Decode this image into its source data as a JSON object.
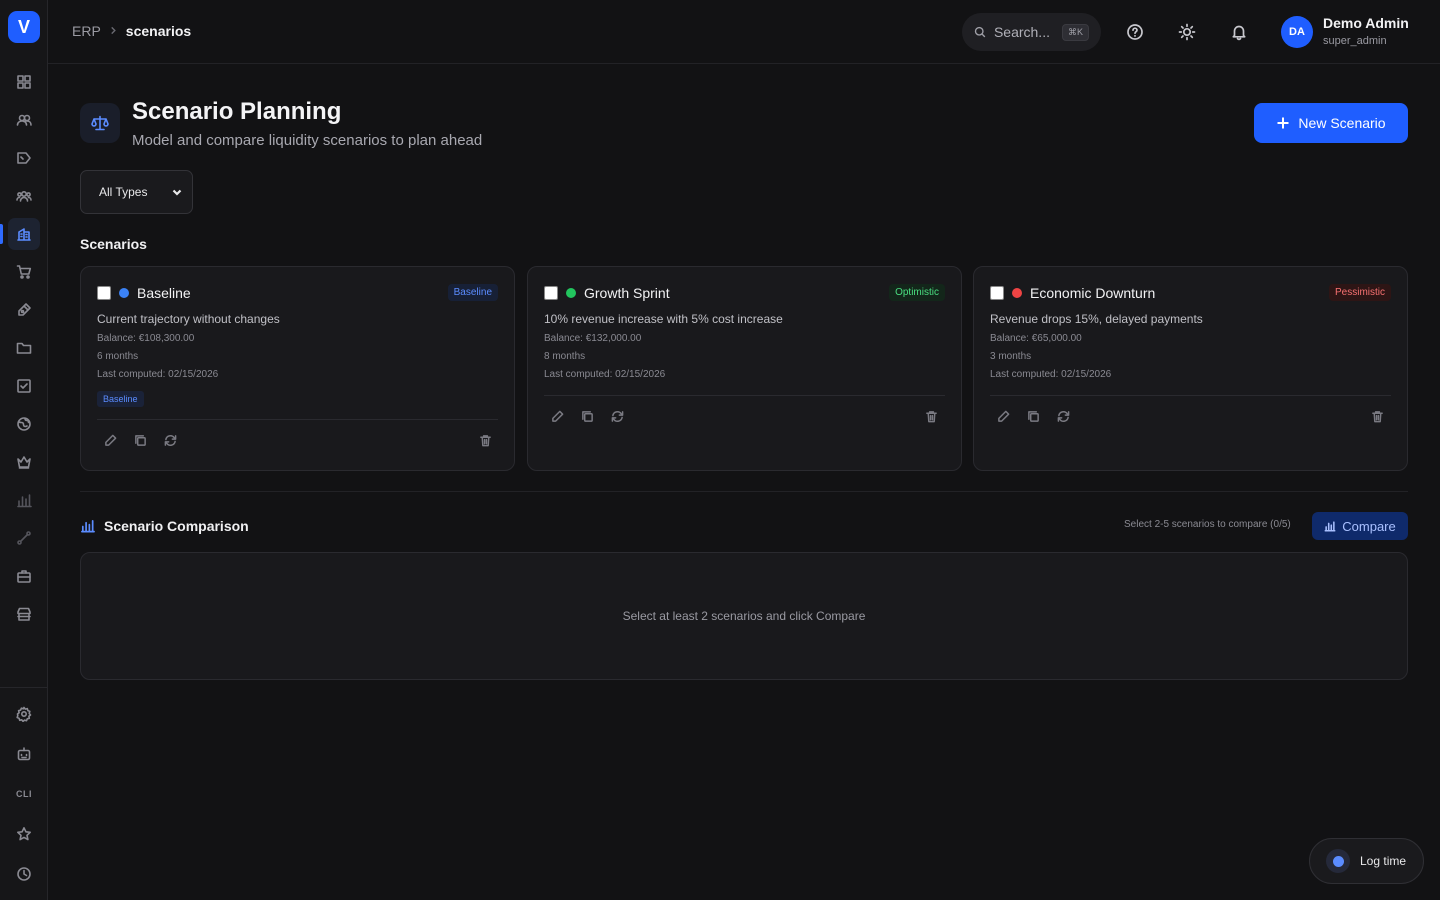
{
  "app": {
    "logo_letter": "V"
  },
  "breadcrumb": {
    "root": "ERP",
    "separator": ">",
    "current": "scenarios"
  },
  "header": {
    "search_placeholder": "Search...",
    "search_shortcut": "⌘K",
    "user": {
      "initials": "DA",
      "name": "Demo Admin",
      "role": "super_admin"
    }
  },
  "sidebar": {
    "items": [
      {
        "icon": "dashboard-icon"
      },
      {
        "icon": "users-icon"
      },
      {
        "icon": "tag-icon"
      },
      {
        "icon": "team-icon"
      },
      {
        "icon": "finance-icon",
        "active": true
      },
      {
        "icon": "cart-icon"
      },
      {
        "icon": "pen-icon"
      },
      {
        "icon": "folder-icon"
      },
      {
        "icon": "task-icon"
      },
      {
        "icon": "globe-icon"
      },
      {
        "icon": "crown-icon"
      },
      {
        "icon": "chart-icon"
      },
      {
        "icon": "route-icon"
      },
      {
        "icon": "briefcase-icon"
      },
      {
        "icon": "store-icon"
      }
    ],
    "bottom": [
      {
        "icon": "settings-icon"
      },
      {
        "icon": "bot-icon"
      },
      {
        "icon": "cli-icon",
        "label": "CLI"
      },
      {
        "icon": "star-icon"
      },
      {
        "icon": "clock-icon"
      }
    ],
    "accent": "#2f6bff"
  },
  "page": {
    "title": "Scenario Planning",
    "subtitle": "Model and compare liquidity scenarios to plan ahead",
    "new_button": "New Scenario",
    "filter_value": "All Types",
    "section_label": "Scenarios"
  },
  "scenarios": [
    {
      "name": "Baseline",
      "badge": "Baseline",
      "dot_color": "#3b82f6",
      "badge_color": "#5b8cff",
      "badge_bg": "#172036",
      "description": "Current trajectory without changes",
      "balance": "Balance: €108,300.00",
      "duration": "6 months",
      "last_computed": "Last computed: 02/15/2026",
      "tag": "Baseline"
    },
    {
      "name": "Growth Sprint",
      "badge": "Optimistic",
      "dot_color": "#22c55e",
      "badge_color": "#4ade80",
      "badge_bg": "#13261a",
      "description": "10% revenue increase with 5% cost increase",
      "balance": "Balance: €132,000.00",
      "duration": "8 months",
      "last_computed": "Last computed: 02/15/2026"
    },
    {
      "name": "Economic Downturn",
      "badge": "Pessimistic",
      "dot_color": "#ef4444",
      "badge_color": "#f87171",
      "badge_bg": "#2d1515",
      "description": "Revenue drops 15%, delayed payments",
      "balance": "Balance: €65,000.00",
      "duration": "3 months",
      "last_computed": "Last computed: 02/15/2026"
    }
  ],
  "comparison": {
    "title": "Scenario Comparison",
    "hint": "Select 2-5 scenarios to compare (0/5)",
    "button": "Compare",
    "empty": "Select at least 2 scenarios and click Compare"
  },
  "log_time": "Log time"
}
